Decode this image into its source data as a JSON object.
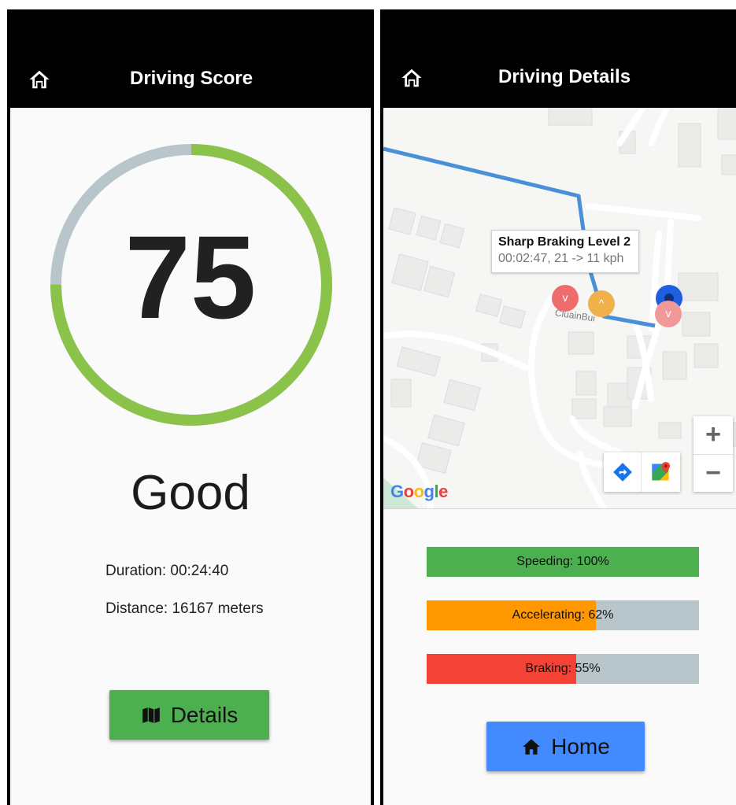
{
  "score_screen": {
    "title": "Driving Score",
    "score": "75",
    "score_fraction": 0.75,
    "rating": "Good",
    "duration": "Duration: 00:24:40",
    "distance": "Distance: 16167 meters",
    "details_label": "Details",
    "colors": {
      "gauge_fill": "#8bc34a",
      "gauge_track": "#b8c6cb",
      "button": "#4caf50"
    }
  },
  "details_screen": {
    "title": "Driving Details",
    "map": {
      "tooltip_title": "Sharp Braking Level 2",
      "tooltip_detail": "00:02:47, 21 -> 11 kph",
      "street_label": "CluainBui",
      "google_logo": "Google",
      "zoom_in": "+",
      "zoom_out": "−",
      "markers": [
        {
          "glyph": "v",
          "color": "#ef6c6c"
        },
        {
          "glyph": "^",
          "color": "#f0b04a"
        },
        {
          "glyph": "",
          "color": "#1e5ee0"
        },
        {
          "glyph": "v",
          "color": "#f19999"
        }
      ]
    },
    "bars": [
      {
        "label": "Speeding: 100%",
        "percent": 100,
        "color": "#4caf50"
      },
      {
        "label": "Accelerating: 62%",
        "percent": 62,
        "color": "#ff9800"
      },
      {
        "label": "Braking: 55%",
        "percent": 55,
        "color": "#f44336"
      }
    ],
    "home_label": "Home",
    "colors": {
      "route": "#4a90d9",
      "button": "#448aff",
      "bar_track": "#b8c6cb"
    }
  }
}
